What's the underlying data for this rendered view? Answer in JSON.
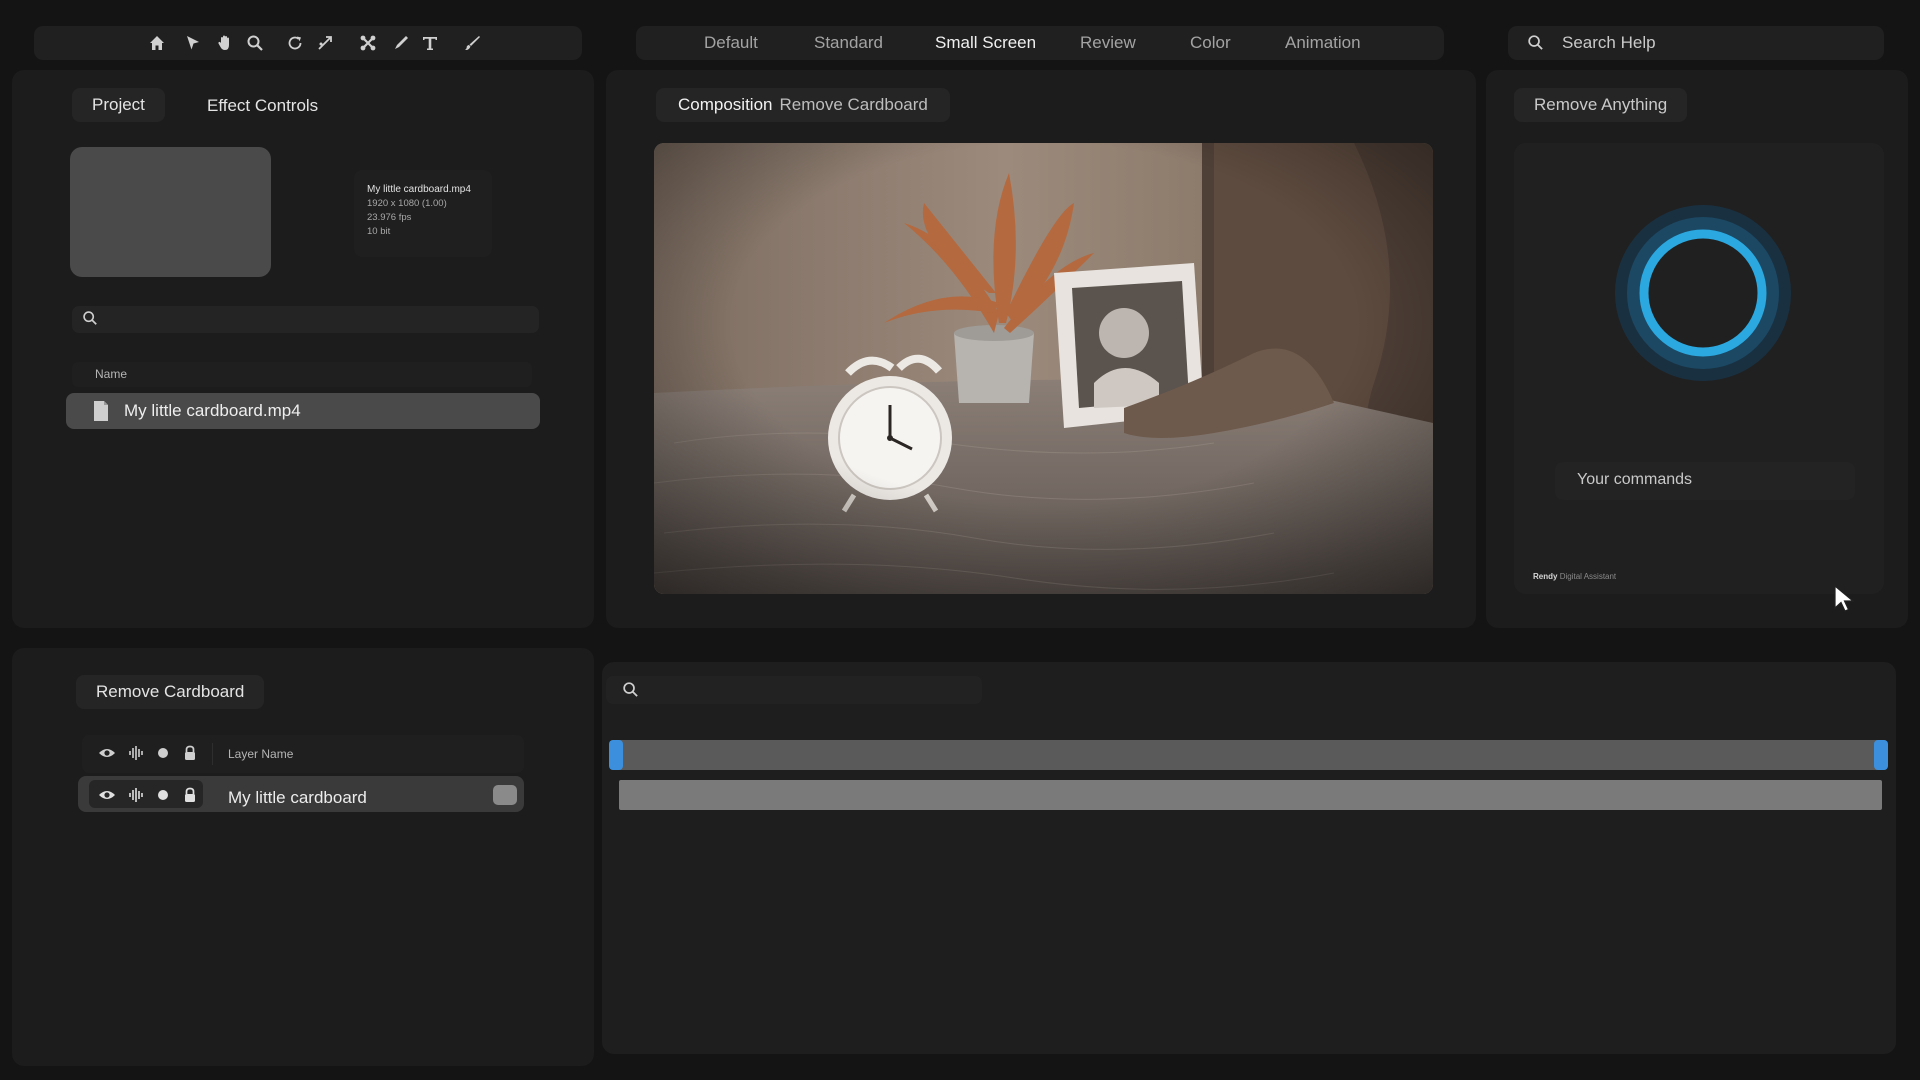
{
  "toolbar": {
    "tools": [
      "home-icon",
      "selection-arrow-icon",
      "hand-icon",
      "zoom-icon",
      "rotate-icon",
      "camera-orbit-icon",
      "puppet-icon",
      "pen-icon",
      "type-icon",
      "brush-icon"
    ]
  },
  "workspaces": {
    "tabs": [
      "Default",
      "Standard",
      "Small Screen",
      "Review",
      "Color",
      "Animation"
    ],
    "active": "Small Screen"
  },
  "help": {
    "search_placeholder": "Search Help"
  },
  "project_panel": {
    "tabs": [
      "Project",
      "Effect Controls"
    ],
    "active_tab": "Project",
    "preview_info": {
      "filename": "My little cardboard.mp4",
      "resolution": "1920 x 1080 (1.00)",
      "fps": "23.976 fps",
      "depth": "10 bit"
    },
    "search_placeholder": "",
    "column_header": "Name",
    "items": [
      {
        "name": "My little cardboard.mp4",
        "type": "file-icon"
      }
    ]
  },
  "composition_panel": {
    "tab_label": "Composition",
    "comp_name": "Remove Cardboard"
  },
  "assistant_panel": {
    "title": "Remove Anything",
    "command_placeholder": "Your commands",
    "footer_brand": "Rendy",
    "footer_sub": "Digital Assistant",
    "accent": "#2ba8e0"
  },
  "timeline": {
    "comp_tab": "Remove Cardboard",
    "layer_header_label": "Layer Name",
    "header_icons": [
      "eye-icon",
      "audio-icon",
      "solo-icon",
      "lock-icon"
    ],
    "layers": [
      {
        "name": "My little cardboard"
      }
    ],
    "search_placeholder": "",
    "playhead_color": "#3b8fdc"
  }
}
